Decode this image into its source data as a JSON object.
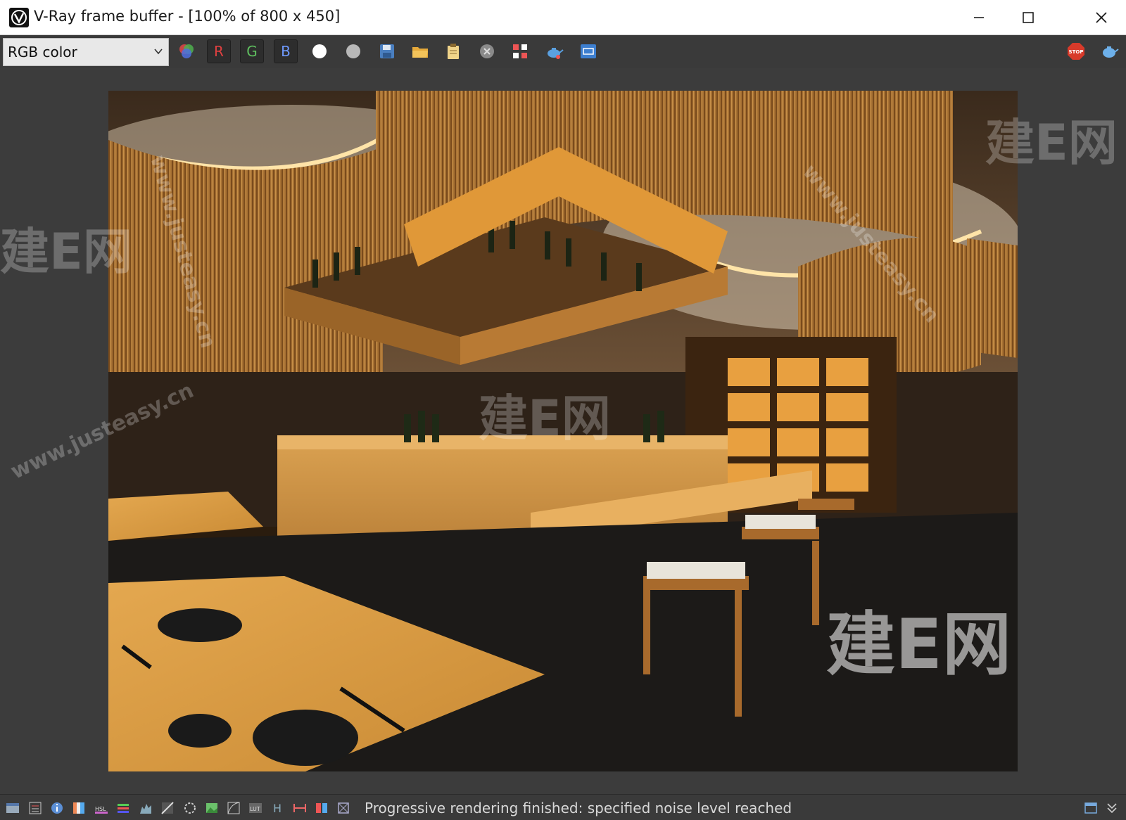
{
  "window": {
    "title": "V-Ray frame buffer - [100% of 800 x 450]",
    "minimize_icon": "minimize-icon",
    "maximize_icon": "maximize-icon",
    "close_icon": "close-icon"
  },
  "toolbar": {
    "channel": "RGB color",
    "red_label": "R",
    "green_label": "G",
    "blue_label": "B",
    "icons": [
      "color-channels-icon",
      "red-channel",
      "green-channel",
      "blue-channel",
      "view-white-icon",
      "view-alpha-icon",
      "save-icon",
      "open-icon",
      "clipboard-icon",
      "clear-icon",
      "track-mouse-icon",
      "render-teapot-icon",
      "region-icon",
      "stop-icon",
      "render-icon"
    ],
    "stop_label": "STOP"
  },
  "render": {
    "content": "Japanese restaurant interior render"
  },
  "watermarks": [
    "建E网",
    "www.justeasy.cn"
  ],
  "status": {
    "message": "Progressive rendering finished: specified noise level reached"
  }
}
